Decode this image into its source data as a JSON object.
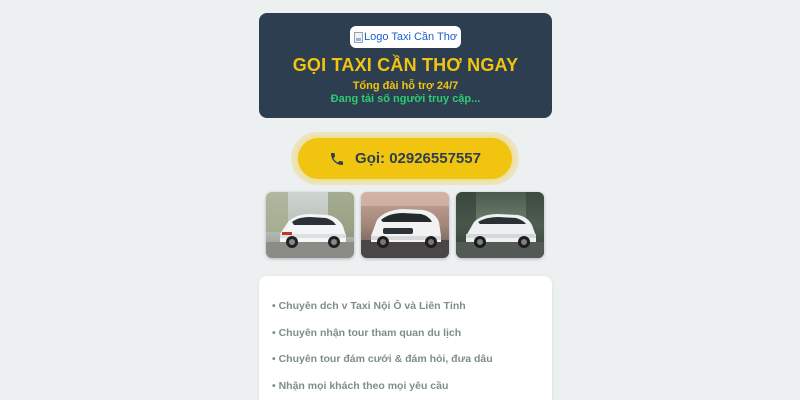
{
  "header": {
    "logo_alt": "Logo Taxi Cần Thơ",
    "cta_title": "GỌI TAXI CẦN THƠ NGAY",
    "support_line": "Tổng đài hỗ trợ 24/7",
    "visitor_line": "Đang tải số người truy cập..."
  },
  "call": {
    "label": "Gọi: 02926557557",
    "icon": "phone-icon"
  },
  "gallery": {
    "images": [
      {
        "name": "car-photo-white-mpv-1"
      },
      {
        "name": "car-photo-white-mpv-2"
      },
      {
        "name": "car-photo-white-mpv-3"
      }
    ]
  },
  "services": {
    "items": [
      "• Chuyên dch v Taxi Nội Ô và Liên Tỉnh",
      "• Chuyên nhận tour tham quan du lịch",
      "• Chuyên tour đám cưới & đám hỏi, đưa dâu",
      "• Nhận mọi khách theo mọi yêu cầu"
    ]
  },
  "colors": {
    "background": "#ecf0f1",
    "header_bg": "#2c3e50",
    "accent_yellow": "#f1c40f",
    "accent_green": "#2ecc71",
    "service_text": "#7f8c8d"
  }
}
